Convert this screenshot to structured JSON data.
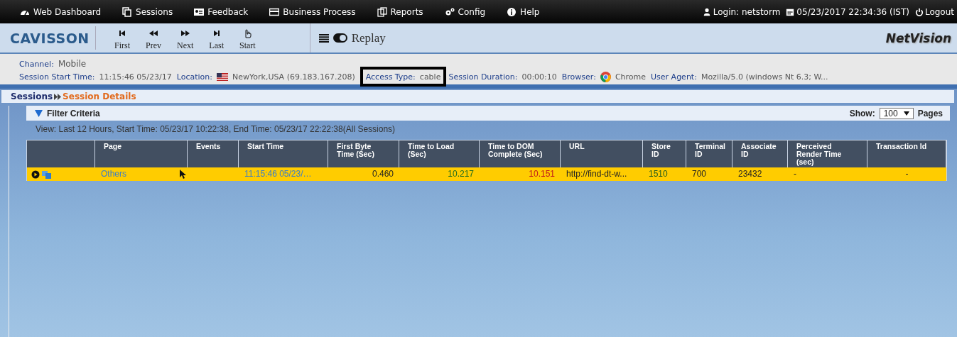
{
  "top_menu": [
    "Web Dashboard",
    "Sessions",
    "Feedback",
    "Business Process",
    "Reports",
    "Config",
    "Help"
  ],
  "user": {
    "login": "Login: netstorm",
    "datetime": "05/23/2017 22:34:36 (IST)",
    "logout": "Logout"
  },
  "toolbar": {
    "logo": "CAVISSON",
    "nav": [
      "First",
      "Prev",
      "Next",
      "Last",
      "Start"
    ],
    "replay": "Replay",
    "product": "NetVision"
  },
  "info": {
    "channel_label": "Channel:",
    "channel": "Mobile",
    "fields": [
      {
        "label": "Session Start Time:",
        "value": "11:15:46 05/23/17",
        "highlighted": false
      },
      {
        "label": "Location:",
        "value": "NewYork,USA (69.183.167.208)",
        "highlighted": false
      },
      {
        "label": "Access Type:",
        "value": "cable",
        "highlighted": true
      },
      {
        "label": "Session Duration:",
        "value": "00:00:10",
        "highlighted": false
      },
      {
        "label": "Browser:",
        "value": "Chrome",
        "highlighted": false
      },
      {
        "label": "User Agent:",
        "value": "Mozilla/5.0 (windows Nt 6.3; W...",
        "highlighted": false
      }
    ]
  },
  "breadcrumb": {
    "parent": "Sessions",
    "current": "Session Details"
  },
  "filter": {
    "title": "Filter Criteria",
    "expanded": true,
    "show_label": "Show:",
    "show_value": "100",
    "pages_label": "Pages"
  },
  "view_line": "View: Last 12 Hours, Start Time: 05/23/17 10:22:38, End Time: 05/23/17 22:22:38(All Sessions)",
  "table": {
    "columns": [
      "Page",
      "Events",
      "Start Time",
      "First Byte Time (Sec)",
      "Time to Load (Sec)",
      "Time to DOM Complete (Sec)",
      "URL",
      "Store ID",
      "Terminal ID",
      "Associate ID",
      "Perceived Render Time (sec)",
      "Transaction Id"
    ],
    "rows": [
      {
        "selected": true,
        "cells": [
          {
            "text": "Others",
            "kind": "link"
          },
          {
            "text": "",
            "kind": "plain"
          },
          {
            "text": "11:15:46 05/23/…",
            "kind": "link"
          },
          {
            "text": "0.460",
            "kind": "number"
          },
          {
            "text": "10.217",
            "kind": "good"
          },
          {
            "text": "10.151",
            "kind": "bad"
          },
          {
            "text": "http://find-dt-w...",
            "kind": "plain"
          },
          {
            "text": "1510",
            "kind": "store"
          },
          {
            "text": "700",
            "kind": "plain"
          },
          {
            "text": "23432",
            "kind": "plain"
          },
          {
            "text": "-",
            "kind": "plain"
          },
          {
            "text": "-",
            "kind": "center"
          }
        ]
      }
    ]
  }
}
